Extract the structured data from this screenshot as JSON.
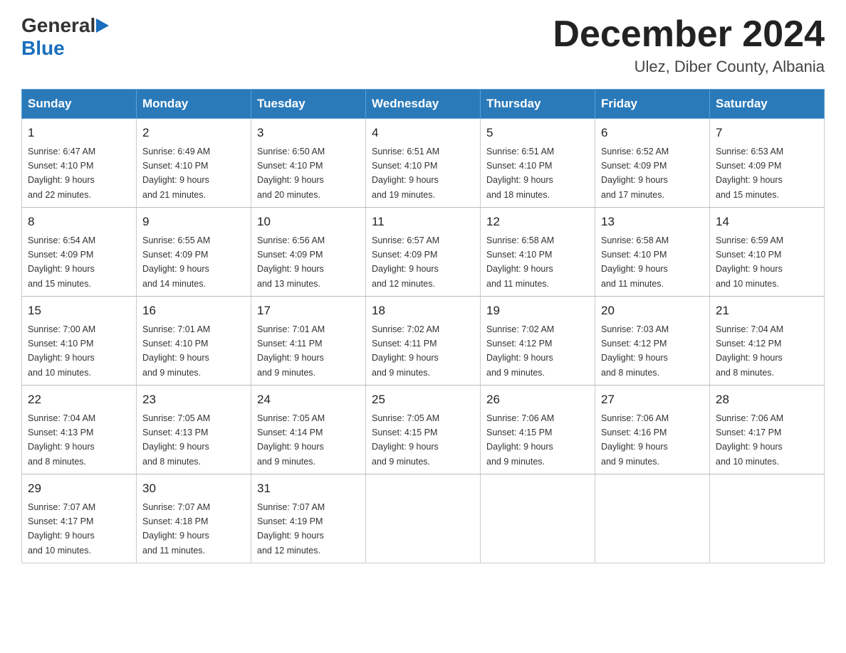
{
  "header": {
    "logo_general": "General",
    "logo_blue": "Blue",
    "month_year": "December 2024",
    "location": "Ulez, Diber County, Albania"
  },
  "weekdays": [
    "Sunday",
    "Monday",
    "Tuesday",
    "Wednesday",
    "Thursday",
    "Friday",
    "Saturday"
  ],
  "weeks": [
    [
      {
        "day": "1",
        "sunrise": "6:47 AM",
        "sunset": "4:10 PM",
        "daylight": "9 hours and 22 minutes."
      },
      {
        "day": "2",
        "sunrise": "6:49 AM",
        "sunset": "4:10 PM",
        "daylight": "9 hours and 21 minutes."
      },
      {
        "day": "3",
        "sunrise": "6:50 AM",
        "sunset": "4:10 PM",
        "daylight": "9 hours and 20 minutes."
      },
      {
        "day": "4",
        "sunrise": "6:51 AM",
        "sunset": "4:10 PM",
        "daylight": "9 hours and 19 minutes."
      },
      {
        "day": "5",
        "sunrise": "6:51 AM",
        "sunset": "4:10 PM",
        "daylight": "9 hours and 18 minutes."
      },
      {
        "day": "6",
        "sunrise": "6:52 AM",
        "sunset": "4:09 PM",
        "daylight": "9 hours and 17 minutes."
      },
      {
        "day": "7",
        "sunrise": "6:53 AM",
        "sunset": "4:09 PM",
        "daylight": "9 hours and 15 minutes."
      }
    ],
    [
      {
        "day": "8",
        "sunrise": "6:54 AM",
        "sunset": "4:09 PM",
        "daylight": "9 hours and 15 minutes."
      },
      {
        "day": "9",
        "sunrise": "6:55 AM",
        "sunset": "4:09 PM",
        "daylight": "9 hours and 14 minutes."
      },
      {
        "day": "10",
        "sunrise": "6:56 AM",
        "sunset": "4:09 PM",
        "daylight": "9 hours and 13 minutes."
      },
      {
        "day": "11",
        "sunrise": "6:57 AM",
        "sunset": "4:09 PM",
        "daylight": "9 hours and 12 minutes."
      },
      {
        "day": "12",
        "sunrise": "6:58 AM",
        "sunset": "4:10 PM",
        "daylight": "9 hours and 11 minutes."
      },
      {
        "day": "13",
        "sunrise": "6:58 AM",
        "sunset": "4:10 PM",
        "daylight": "9 hours and 11 minutes."
      },
      {
        "day": "14",
        "sunrise": "6:59 AM",
        "sunset": "4:10 PM",
        "daylight": "9 hours and 10 minutes."
      }
    ],
    [
      {
        "day": "15",
        "sunrise": "7:00 AM",
        "sunset": "4:10 PM",
        "daylight": "9 hours and 10 minutes."
      },
      {
        "day": "16",
        "sunrise": "7:01 AM",
        "sunset": "4:10 PM",
        "daylight": "9 hours and 9 minutes."
      },
      {
        "day": "17",
        "sunrise": "7:01 AM",
        "sunset": "4:11 PM",
        "daylight": "9 hours and 9 minutes."
      },
      {
        "day": "18",
        "sunrise": "7:02 AM",
        "sunset": "4:11 PM",
        "daylight": "9 hours and 9 minutes."
      },
      {
        "day": "19",
        "sunrise": "7:02 AM",
        "sunset": "4:12 PM",
        "daylight": "9 hours and 9 minutes."
      },
      {
        "day": "20",
        "sunrise": "7:03 AM",
        "sunset": "4:12 PM",
        "daylight": "9 hours and 8 minutes."
      },
      {
        "day": "21",
        "sunrise": "7:04 AM",
        "sunset": "4:12 PM",
        "daylight": "9 hours and 8 minutes."
      }
    ],
    [
      {
        "day": "22",
        "sunrise": "7:04 AM",
        "sunset": "4:13 PM",
        "daylight": "9 hours and 8 minutes."
      },
      {
        "day": "23",
        "sunrise": "7:05 AM",
        "sunset": "4:13 PM",
        "daylight": "9 hours and 8 minutes."
      },
      {
        "day": "24",
        "sunrise": "7:05 AM",
        "sunset": "4:14 PM",
        "daylight": "9 hours and 9 minutes."
      },
      {
        "day": "25",
        "sunrise": "7:05 AM",
        "sunset": "4:15 PM",
        "daylight": "9 hours and 9 minutes."
      },
      {
        "day": "26",
        "sunrise": "7:06 AM",
        "sunset": "4:15 PM",
        "daylight": "9 hours and 9 minutes."
      },
      {
        "day": "27",
        "sunrise": "7:06 AM",
        "sunset": "4:16 PM",
        "daylight": "9 hours and 9 minutes."
      },
      {
        "day": "28",
        "sunrise": "7:06 AM",
        "sunset": "4:17 PM",
        "daylight": "9 hours and 10 minutes."
      }
    ],
    [
      {
        "day": "29",
        "sunrise": "7:07 AM",
        "sunset": "4:17 PM",
        "daylight": "9 hours and 10 minutes."
      },
      {
        "day": "30",
        "sunrise": "7:07 AM",
        "sunset": "4:18 PM",
        "daylight": "9 hours and 11 minutes."
      },
      {
        "day": "31",
        "sunrise": "7:07 AM",
        "sunset": "4:19 PM",
        "daylight": "9 hours and 12 minutes."
      },
      null,
      null,
      null,
      null
    ]
  ],
  "labels": {
    "sunrise": "Sunrise:",
    "sunset": "Sunset:",
    "daylight": "Daylight:"
  }
}
